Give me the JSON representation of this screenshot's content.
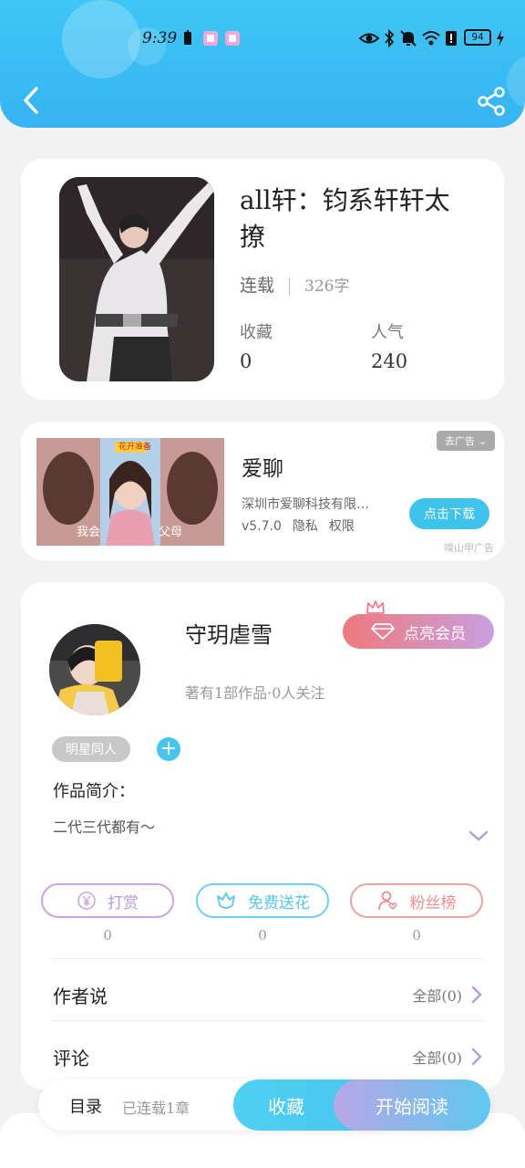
{
  "status_bar": {
    "time": "9:39",
    "battery": "94"
  },
  "book": {
    "title": "all轩：钧系轩轩太撩",
    "status": "连载",
    "word_count": "326字",
    "fav_label": "收藏",
    "fav_value": "0",
    "pop_label": "人气",
    "pop_value": "240"
  },
  "ad": {
    "tag": "去广告",
    "app_name": "爱聊",
    "company": "深圳市爱聊科技有限…",
    "version": "v5.7.0",
    "privacy": "隐私",
    "permissions": "权限",
    "download_label": "点击下载",
    "source": "嗅山甲广告",
    "image_caption": "花开准备",
    "image_left_text": "我会",
    "image_right_text": "父母"
  },
  "author": {
    "name": "守玥虐雪",
    "info": "著有1部作品·0人关注",
    "vip_label": "点亮会员",
    "tag": "明星同人",
    "intro_label": "作品简介：",
    "intro_text": "二代三代都有～"
  },
  "actions": [
    {
      "label": "打赏",
      "value": "0",
      "color": "#b79ad8"
    },
    {
      "label": "免费送花",
      "value": "0",
      "color": "#52c8ec"
    },
    {
      "label": "粉丝榜",
      "value": "0",
      "color": "#ee8d8d"
    }
  ],
  "rows": {
    "author_says": {
      "label": "作者说",
      "right": "全部(0)"
    },
    "comments": {
      "label": "评论",
      "right": "全部(0)"
    }
  },
  "bottom_bar": {
    "toc": "目录",
    "chapters": "已连载1章",
    "favorite": "收藏",
    "read": "开始阅读"
  }
}
